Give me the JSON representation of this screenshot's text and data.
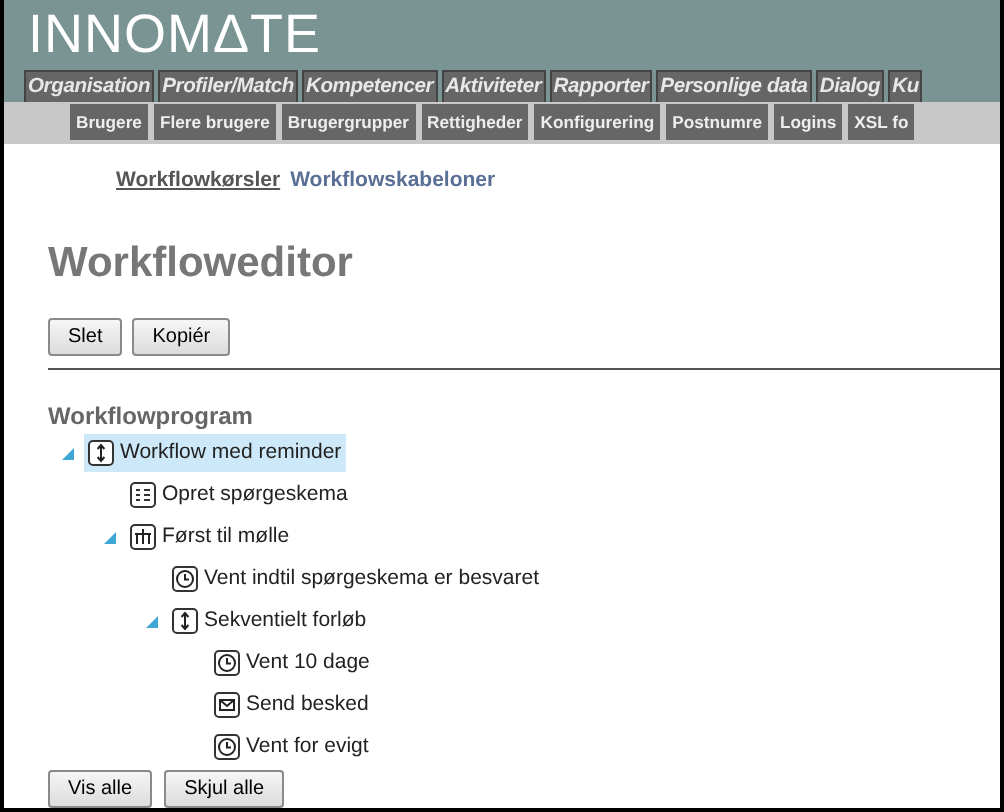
{
  "logo": "INNOMΔTE",
  "main_tabs": [
    "Organisation",
    "Profiler/Match",
    "Kompetencer",
    "Aktiviteter",
    "Rapporter",
    "Personlige data",
    "Dialog",
    "Ku"
  ],
  "sub_tabs": [
    "Brugere",
    "Flere brugere",
    "Brugergrupper",
    "Rettigheder",
    "Konfigurering",
    "Postnumre",
    "Logins",
    "XSL fo"
  ],
  "links": [
    {
      "label": "Workflowkørsler",
      "selected": true
    },
    {
      "label": "Workflowskabeloner",
      "selected": false
    }
  ],
  "title": "Workfloweditor",
  "toolbar_buttons": [
    "Slet",
    "Kopiér"
  ],
  "section_title": "Workflowprogram",
  "tree": [
    {
      "label": "Workflow med reminder",
      "kind": "sequence",
      "selected": true,
      "expanded": true,
      "children": [
        {
          "label": "Opret spørgeskema",
          "kind": "form",
          "selected": false
        },
        {
          "label": "Først til mølle",
          "kind": "parallel",
          "selected": false,
          "expanded": true,
          "children": [
            {
              "label": "Vent indtil spørgeskema er besvaret",
              "kind": "wait",
              "selected": false
            },
            {
              "label": "Sekventielt forløb",
              "kind": "sequence",
              "selected": false,
              "expanded": true,
              "children": [
                {
                  "label": "Vent 10 dage",
                  "kind": "wait",
                  "selected": false
                },
                {
                  "label": "Send besked",
                  "kind": "message",
                  "selected": false
                },
                {
                  "label": "Vent for evigt",
                  "kind": "wait",
                  "selected": false
                }
              ]
            }
          ]
        }
      ]
    }
  ],
  "bottom_buttons": [
    "Vis alle",
    "Skjul alle"
  ]
}
